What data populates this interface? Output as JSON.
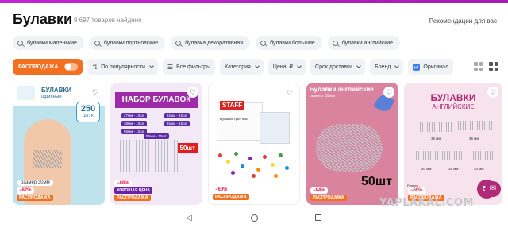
{
  "header": {
    "title": "Булавки",
    "count": "9 697 товаров найдено",
    "recommendations": "Рекомендации для вас"
  },
  "chips": [
    {
      "label": "булавки маленькие"
    },
    {
      "label": "булавки портновские"
    },
    {
      "label": "булавка декоративная"
    },
    {
      "label": "булавки большие"
    },
    {
      "label": "булавки английские"
    }
  ],
  "filters": {
    "sale": "РАСПРОДАЖА",
    "popularity": "По популярности",
    "all_filters": "Все фильтры",
    "category": "Категория",
    "price": "Цена, ₽",
    "delivery": "Срок доставки",
    "brand": "Бренд",
    "original": "Оригинал"
  },
  "cards": [
    {
      "title": "БУЛАВКИ",
      "subtitle": "офисные",
      "count": "250",
      "unit": "ШТУК",
      "size": "размер 30мм",
      "discount": "−87%",
      "tag": "РАСПРОДАЖА"
    },
    {
      "title": "НАБОР БУЛАВОК",
      "rows": [
        "27мм - 10шт",
        "38мм - 10шт",
        "55мм - 10шт",
        "32мм - 10шт",
        "45мм - 10шт",
        "55мм - 10шт"
      ],
      "count_badge": "50шт",
      "quality": "ХОРОШАЯ ЦЕНА",
      "discount": "−88%",
      "tag": "РАСПРОДАЖА"
    },
    {
      "brand": "STAFF",
      "box_text": "Булавки цветные",
      "discount": "−60%",
      "tag": "РАСПРОДАЖА"
    },
    {
      "title": "Булавки английские",
      "subtitle": "размер: 18мм",
      "count": "50шт",
      "discount": "−84%",
      "tag": "РАСПРОДАЖА"
    },
    {
      "title": "БУЛАВКИ",
      "subtitle": "АНГЛИЙСКИЕ",
      "sizes": [
        "35 мм",
        "45 мм",
        "40 мм",
        "35 мм",
        "30 мм"
      ],
      "count": "50",
      "razm": "Размер",
      "discount": "−69%",
      "tag": "РАСПРОДАЖА"
    }
  ],
  "watermark": "YAPLAKAL.COM",
  "colors": {
    "accent": "#f37020",
    "brand": "#c026d3",
    "discount": "#e11d48"
  }
}
